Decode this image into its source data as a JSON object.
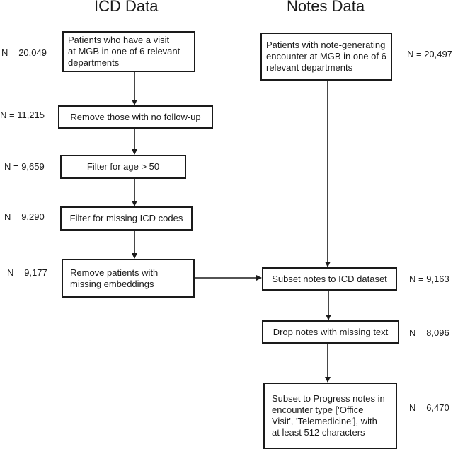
{
  "titles": {
    "icd": "ICD Data",
    "notes": "Notes Data"
  },
  "icd_steps": [
    {
      "label": "Patients who have a visit\nat MGB in one of 6 relevant\ndepartments",
      "n": "N = 20,049"
    },
    {
      "label": "Remove those with no follow-up",
      "n": "N = 11,215"
    },
    {
      "label": "Filter for age > 50",
      "n": "N = 9,659"
    },
    {
      "label": "Filter for missing ICD codes",
      "n": "N = 9,290"
    },
    {
      "label": "Remove patients with\nmissing embeddings",
      "n": "N = 9,177"
    }
  ],
  "notes_steps": [
    {
      "label": "Patients with note-generating\nencounter at MGB in one of 6\nrelevant departments",
      "n": "N = 20,497"
    },
    {
      "label": "Subset notes to ICD dataset",
      "n": "N = 9,163"
    },
    {
      "label": "Drop notes with missing text",
      "n": "N = 8,096"
    },
    {
      "label": "Subset to Progress notes in\nencounter type ['Office\nVisit', 'Telemedicine'], with\nat least 512 characters",
      "n": "N = 6,470"
    }
  ]
}
